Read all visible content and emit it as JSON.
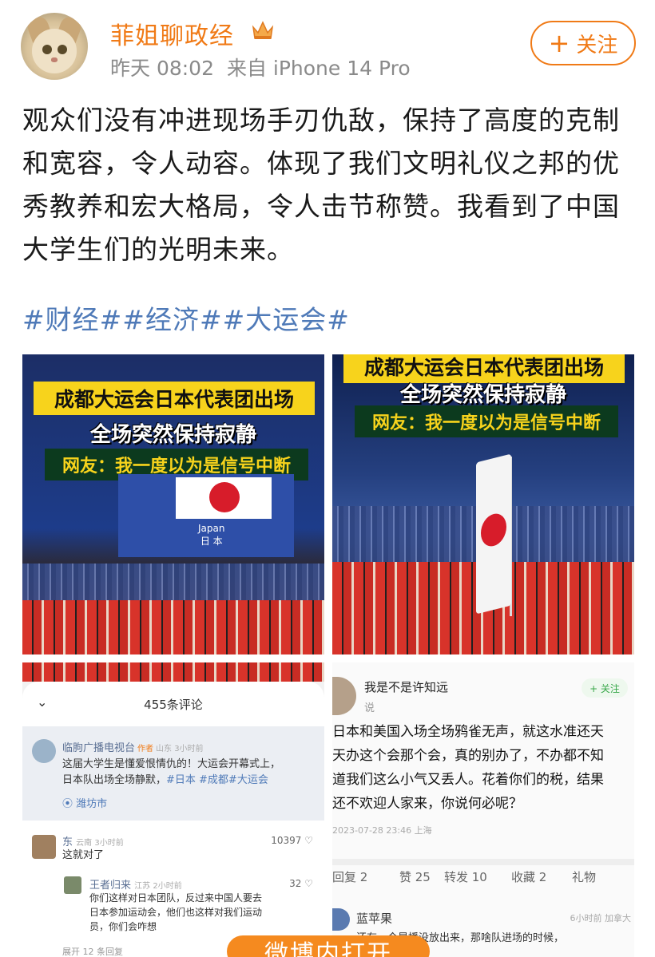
{
  "post": {
    "username": "菲姐聊政经",
    "time": "昨天 08:02",
    "source": "来自 iPhone 14 Pro",
    "follow_label": "关注",
    "body": "观众们没有冲进现场手刃仇敌，保持了高度的克制和宽容，令人动容。体现了我们文明礼仪之邦的优秀教养和宏大格局，令人击节称赞。我看到了中国大学生们的光明未来。",
    "hashtags": "#财经##经济##大运会#"
  },
  "image1": {
    "caption1": "成都大运会日本代表团出场",
    "caption2": "全场突然保持寂静",
    "caption3": "网友：我一度以为是信号中断",
    "screen_label_en": "Japan",
    "screen_label_zh": "日 本"
  },
  "image2": {
    "caption1": "成都大运会日本代表团出场",
    "caption2": "全场突然保持寂静",
    "caption3": "网友：我一度以为是信号中断"
  },
  "image3": {
    "comment_count": "455条评论",
    "c1_name": "临朐广播电视台",
    "c1_tag": "作者",
    "c1_meta": "山东 3小时前",
    "c1_text_1": "这届大学生是懂爱恨情仇的！大运会开幕式上，",
    "c1_text_2": "日本队出场全场静默，",
    "c1_text_tags": "#日本 #成都#大运会",
    "c1_location": "潍坊市",
    "c2_name": "东",
    "c2_meta": "云南 3小时前",
    "c2_likes": "10397",
    "c2_text": "这就对了",
    "c3_name": "王者归来",
    "c3_meta": "江苏 2小时前",
    "c3_likes": "32",
    "c3_text_1": "你们这样对日本团队，反过来中国人要去",
    "c3_text_2": "日本参加运动会，他们也这样对我们运动",
    "c3_text_3": "员，你们会咋想",
    "replies": "展开 12 条回复"
  },
  "image4": {
    "name": "我是不是许知远",
    "sub": "说",
    "follow": "+ 关注",
    "text": "日本和美国入场全场鸦雀无声，就这水准还天\n天办这个会那个会，真的别办了，不办都不知\n道我们这么小气又丢人。花着你们的税，结果\n还不欢迎人家来，你说何必呢？",
    "date": "2023-07-28 23:46 上海",
    "tab_reply": "回复 2",
    "tab_like": "赞 25",
    "tab_forward": "转发 10",
    "tab_collect": "收藏 2",
    "tab_gift": "礼物",
    "cmt_name": "蓝苹果",
    "cmt_meta": "6小时前 加拿大",
    "cmt_text": "还有，今晨播没放出来，那啥队进场的时候，"
  },
  "banner": {
    "label": "微博内打开"
  },
  "colors": {
    "accent_orange": "#f07a16",
    "link_blue": "#4f7ab8",
    "caption_yellow": "#f7d31c"
  }
}
